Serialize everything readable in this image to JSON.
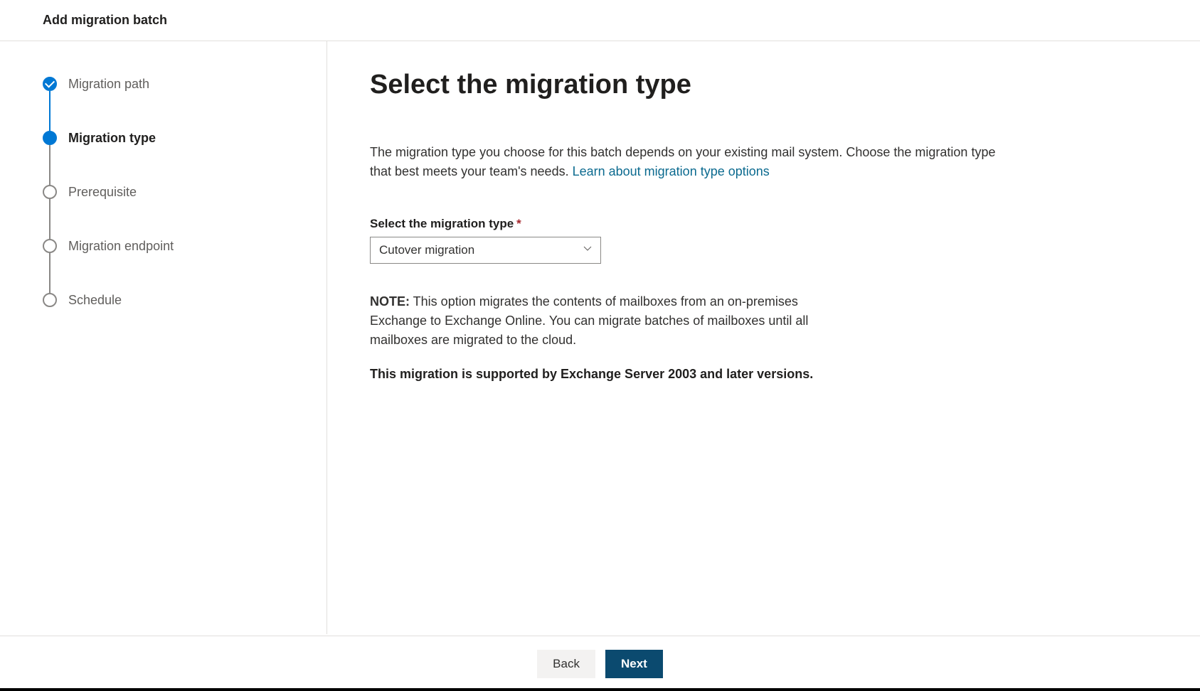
{
  "header": {
    "title": "Add migration batch"
  },
  "stepper": {
    "steps": [
      {
        "label": "Migration path",
        "state": "completed"
      },
      {
        "label": "Migration type",
        "state": "current"
      },
      {
        "label": "Prerequisite",
        "state": "pending"
      },
      {
        "label": "Migration endpoint",
        "state": "pending"
      },
      {
        "label": "Schedule",
        "state": "pending"
      }
    ]
  },
  "content": {
    "title": "Select the migration type",
    "description_text": "The migration type you choose for this batch depends on your existing mail system. Choose the migration type that best meets your team's needs. ",
    "description_link": "Learn about migration type options",
    "field_label": "Select the migration type",
    "select_value": "Cutover migration",
    "note_label": "NOTE:",
    "note_text": " This option migrates the contents of mailboxes from an on-premises Exchange to Exchange Online. You can migrate batches of mailboxes until all mailboxes are migrated to the cloud.",
    "support_text": "This migration is supported by Exchange Server 2003 and later versions."
  },
  "footer": {
    "back_label": "Back",
    "next_label": "Next"
  }
}
